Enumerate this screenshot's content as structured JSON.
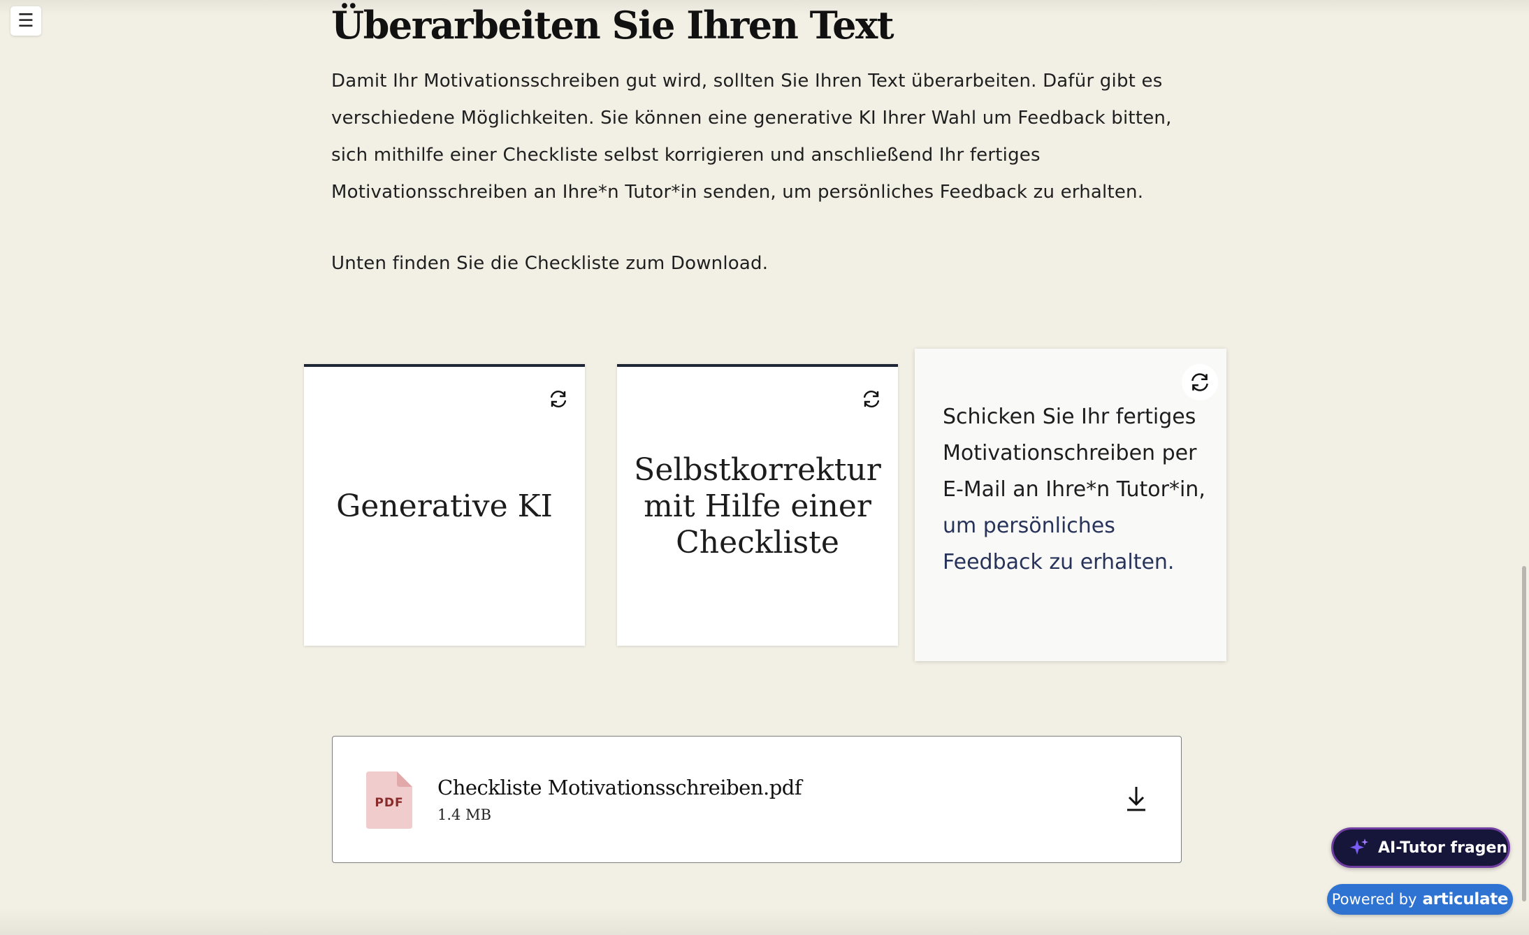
{
  "nav": {
    "menu_icon": "hamburger-icon",
    "menu_glyph": "☰"
  },
  "section": {
    "heading": "Überarbeiten Sie Ihren Text",
    "paragraph": "Damit Ihr Motivationsschreiben gut wird, sollten Sie Ihren Text überarbeiten. Dafür gibt es verschiedene Möglichkeiten. Sie können eine generative KI Ihrer Wahl um Feedback bitten, sich mithilfe einer Checkliste selbst korrigieren und anschließend Ihr fertiges Motivationsschreiben an Ihre*n Tutor*in senden, um persönliches Feedback zu erhalten.",
    "paragraph2": "Unten finden Sie die Checkliste zum Download."
  },
  "flashcards": [
    {
      "front": "Generative KI",
      "icon": "flip-icon"
    },
    {
      "front": "Selbstkorrektur mit Hilfe einer Checkliste",
      "icon": "flip-icon"
    },
    {
      "back_part1": "Schicken Sie Ihr fertiges  Motivationschreiben per E-Mail  an Ihre*n Tutor*in, ",
      "back_part2": "um persönliches Feedback zu erhalten.",
      "icon": "flip-icon"
    }
  ],
  "download": {
    "file_type_label": "PDF",
    "file_name": "Checkliste Motivationsschreiben.pdf",
    "file_size": "1.4 MB",
    "icon": "download-icon"
  },
  "widgets": {
    "ai_tutor_label": "AI-Tutor fragen",
    "ai_icon": "sparkle-icon",
    "powered_prefix": "Powered by",
    "powered_brand": "articulate"
  },
  "colors": {
    "background": "#f2efe5",
    "card_border": "#1f2636",
    "accent_text": "#28335a",
    "ai_button_bg": "#15163a",
    "ai_button_border": "#6f3ea0",
    "powered_bg": "#2f73d2",
    "pdf_icon": "#f0cccc"
  }
}
